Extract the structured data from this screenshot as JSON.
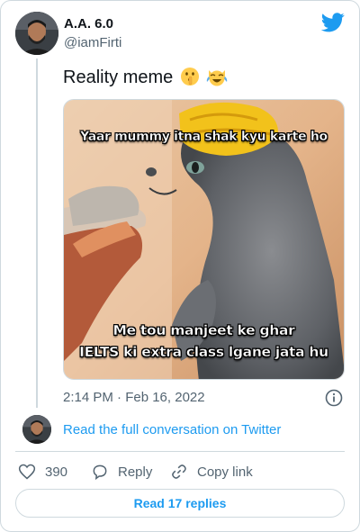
{
  "author": {
    "display_name": "‎A.A. 6.0",
    "handle": "@iamFirti"
  },
  "tweet": {
    "text": "Reality meme",
    "emojis": [
      "shushing-face",
      "crying-laughing-cat"
    ]
  },
  "media": {
    "caption_top": "Yaar mummy itna shak kyu karte ho",
    "caption_bottom_line1": "Me tou manjeet ke ghar",
    "caption_bottom_line2": "IELTS ki extra class lgane jata hu"
  },
  "meta": {
    "timestamp": "2:14 PM · Feb 16, 2022"
  },
  "conversation": {
    "link_text": "Read the full conversation on Twitter"
  },
  "actions": {
    "like_count": "390",
    "reply_label": "Reply",
    "copy_label": "Copy link"
  },
  "footer": {
    "read_replies": "Read 17 replies"
  },
  "colors": {
    "accent": "#1d9bf0",
    "muted": "#536471",
    "border": "#cfd9de"
  }
}
